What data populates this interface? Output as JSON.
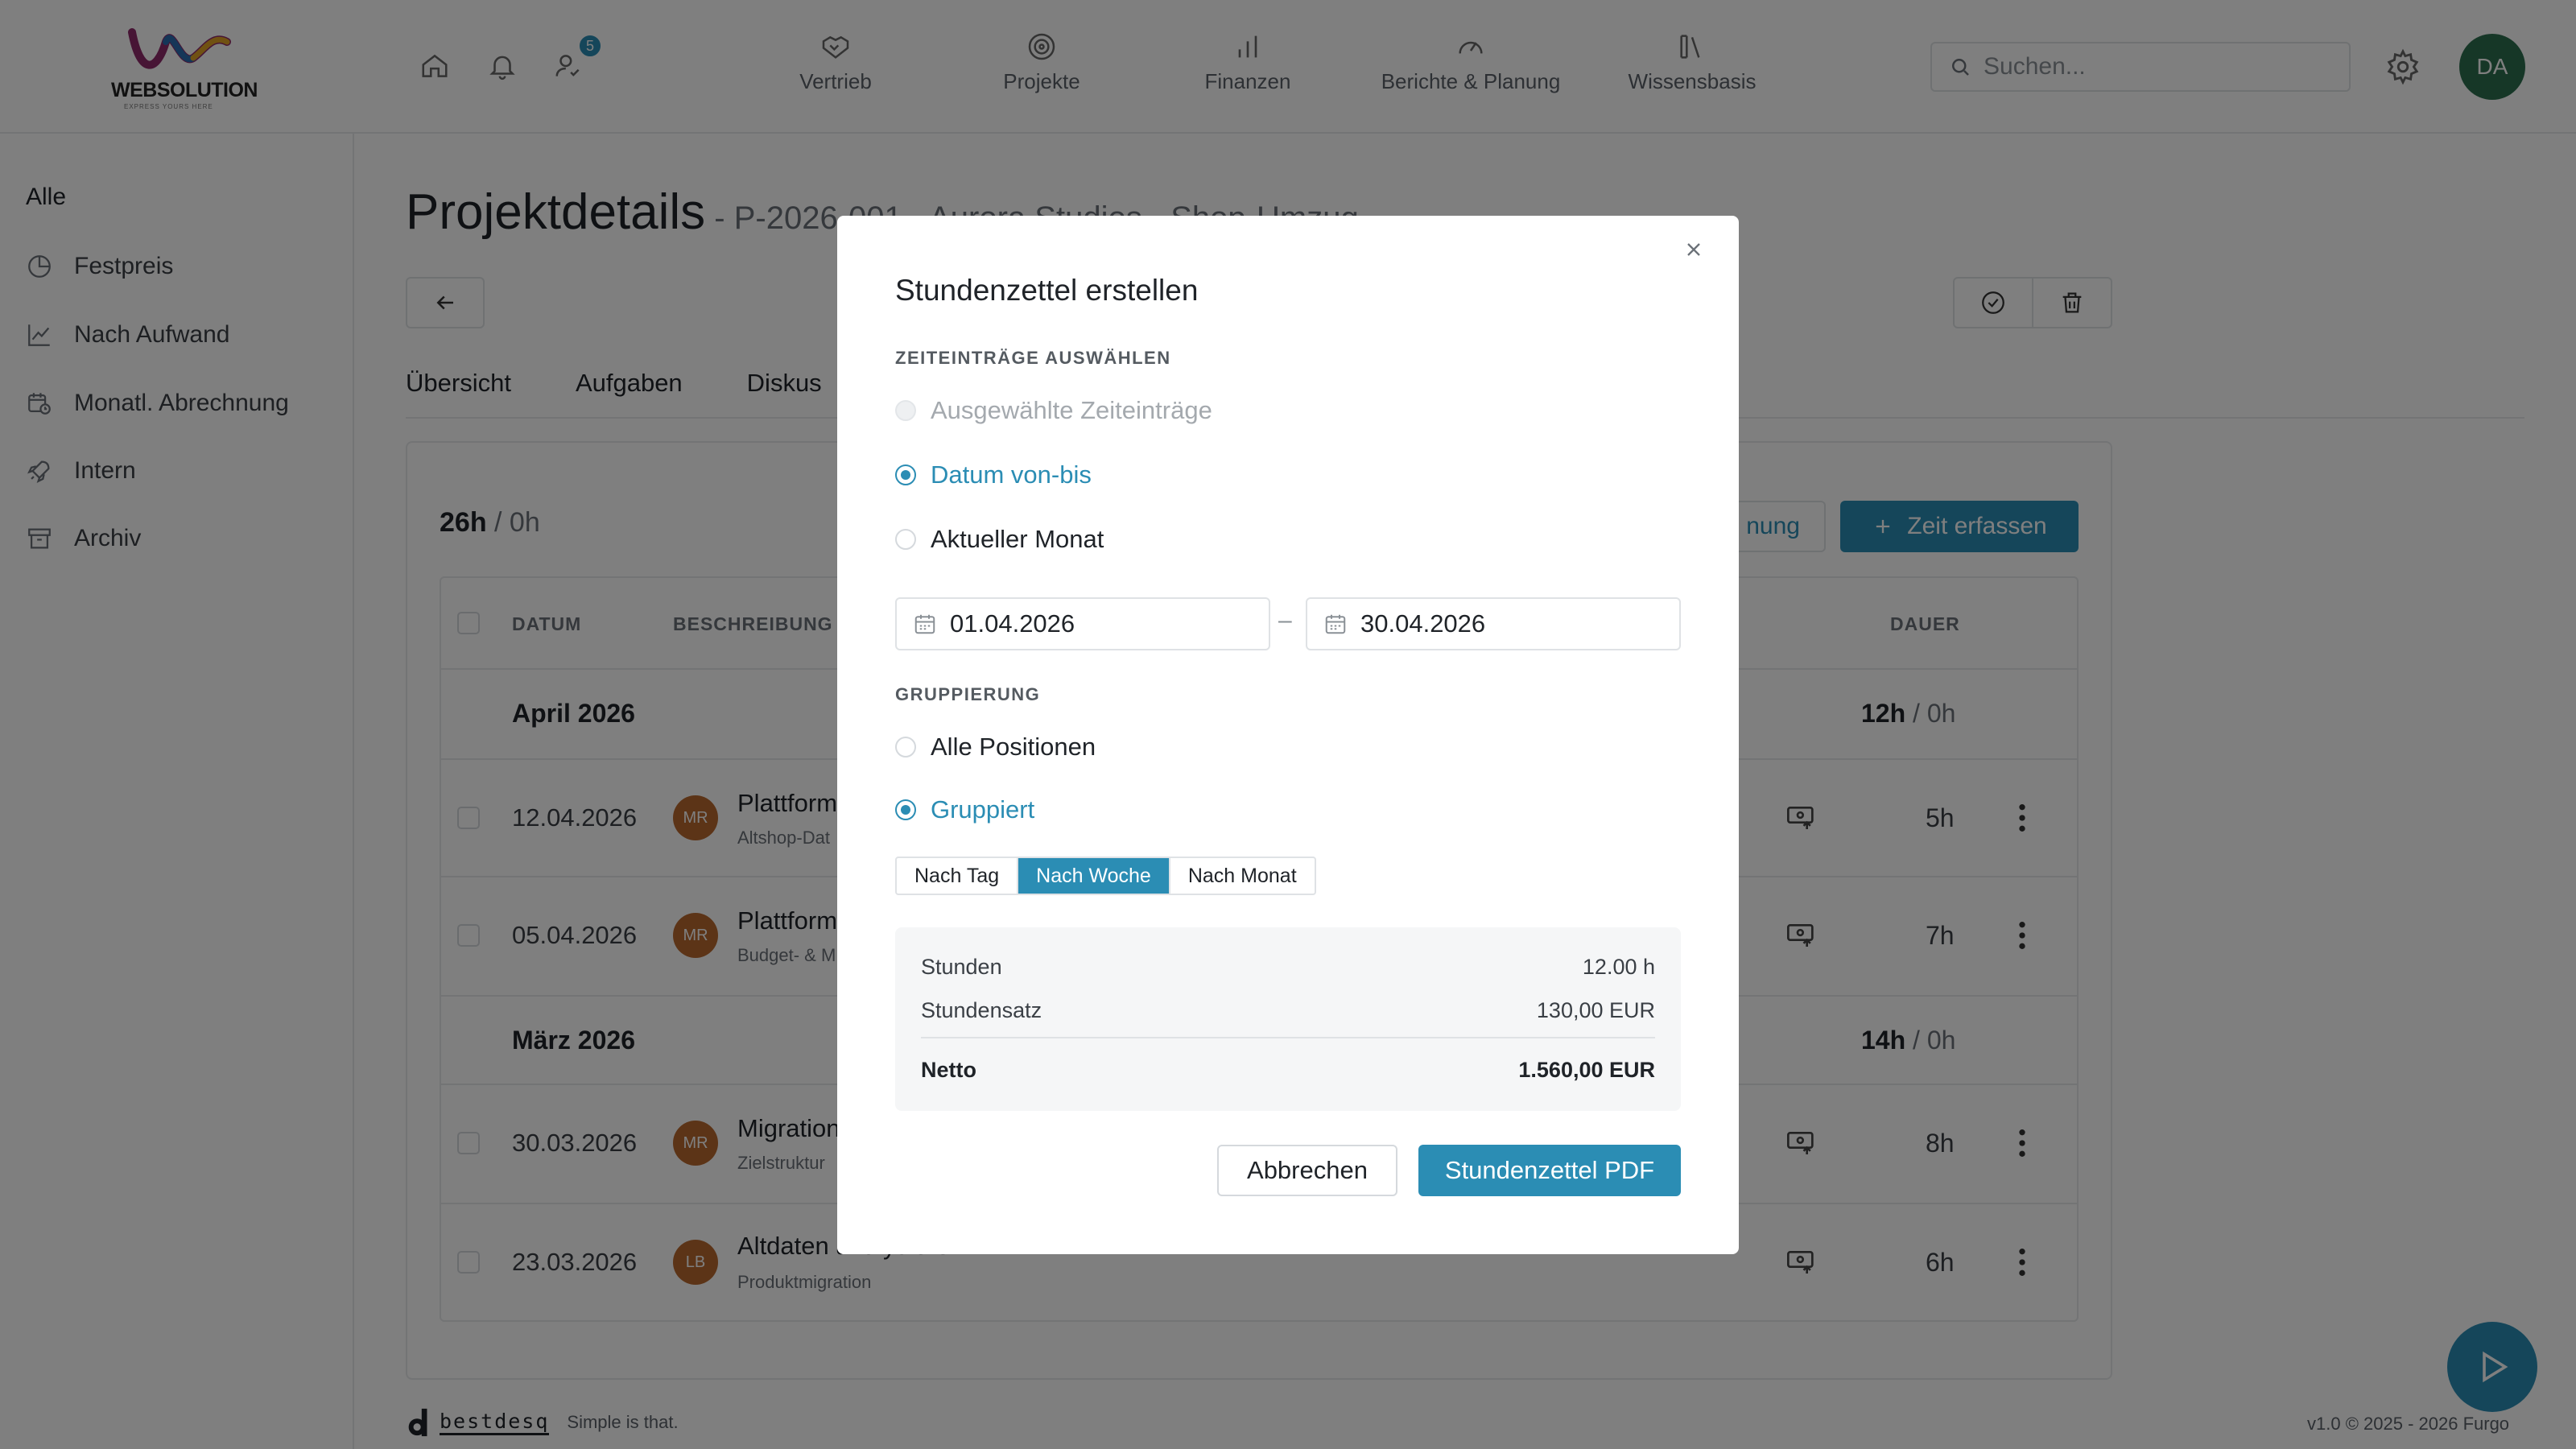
{
  "brand": {
    "logo_main": "WEB",
    "logo_bold": "SOLUTION",
    "logo_tag": "EXPRESS YOURS HERE"
  },
  "header": {
    "notification_count": "5",
    "nav": [
      {
        "label": "Vertrieb",
        "icon": "handshake-icon"
      },
      {
        "label": "Projekte",
        "icon": "target-icon"
      },
      {
        "label": "Finanzen",
        "icon": "bar-chart-icon"
      },
      {
        "label": "Berichte & Planung",
        "icon": "gauge-icon"
      },
      {
        "label": "Wissensbasis",
        "icon": "books-icon"
      }
    ],
    "search_placeholder": "Suchen...",
    "avatar_initials": "DA"
  },
  "sidebar": {
    "all_label": "Alle",
    "items": [
      {
        "label": "Festpreis",
        "icon": "pie-chart-icon"
      },
      {
        "label": "Nach Aufwand",
        "icon": "line-chart-icon"
      },
      {
        "label": "Monatl. Abrechnung",
        "icon": "calendar-clock-icon"
      },
      {
        "label": "Intern",
        "icon": "rocket-icon"
      },
      {
        "label": "Archiv",
        "icon": "archive-icon"
      }
    ]
  },
  "page": {
    "title": "Projektdetails",
    "subtitle": " - P-2026-001 - Aurora Studios - Shop-Umzug",
    "tabs": [
      "Übersicht",
      "Aufgaben",
      "Diskus"
    ],
    "hours_total": "26h",
    "hours_zero": " / 0h",
    "plan_button": "nung",
    "add_time_button": "Zeit erfassen"
  },
  "table": {
    "headers": {
      "date": "DATUM",
      "description": "BESCHREIBUNG",
      "duration": "DAUER"
    },
    "groups": [
      {
        "label": "April 2026",
        "total": "12h",
        "zero": " / 0h"
      },
      {
        "label": "März 2026",
        "total": "14h",
        "zero": " / 0h"
      }
    ],
    "rows": [
      {
        "date": "12.04.2026",
        "initials": "MR",
        "title": "Plattform",
        "subtitle": "Altshop-Dat",
        "duration": "5h"
      },
      {
        "date": "05.04.2026",
        "initials": "MR",
        "title": "Plattform",
        "subtitle": "Budget- & M",
        "duration": "7h"
      },
      {
        "date": "30.03.2026",
        "initials": "MR",
        "title": "Migration",
        "subtitle": "Zielstruktur",
        "duration": "8h"
      },
      {
        "date": "23.03.2026",
        "initials": "LB",
        "title": "Altdaten analysieren",
        "subtitle": "Produktmigration",
        "duration": "6h"
      }
    ]
  },
  "footer": {
    "brand": "bestdesq",
    "slogan": "Simple is that.",
    "version": "v1.0 © 2025 - 2026 Furgo"
  },
  "modal": {
    "title": "Stundenzettel erstellen",
    "section_entries": "ZEITEINTRÄGE AUSWÄHLEN",
    "option_selected": "Ausgewählte Zeiteinträge",
    "option_range": "Datum von-bis",
    "option_month": "Aktueller Monat",
    "date_from": "01.04.2026",
    "date_to": "30.04.2026",
    "date_separator": "–",
    "section_grouping": "GRUPPIERUNG",
    "option_all": "Alle Positionen",
    "option_grouped": "Gruppiert",
    "grouping_modes": [
      "Nach Tag",
      "Nach Woche",
      "Nach Monat"
    ],
    "grouping_active": "Nach Woche",
    "summary": {
      "hours_label": "Stunden",
      "hours_value": "12.00 h",
      "rate_label": "Stundensatz",
      "rate_value": "130,00 EUR",
      "net_label": "Netto",
      "net_value": "1.560,00 EUR"
    },
    "cancel_label": "Abbrechen",
    "pdf_label": "Stundenzettel PDF"
  },
  "colors": {
    "accent": "#2b8db4",
    "avatar_da": "#2d6e4e",
    "avatar_mr": "#b8682f",
    "avatar_lb": "#b8682f"
  }
}
